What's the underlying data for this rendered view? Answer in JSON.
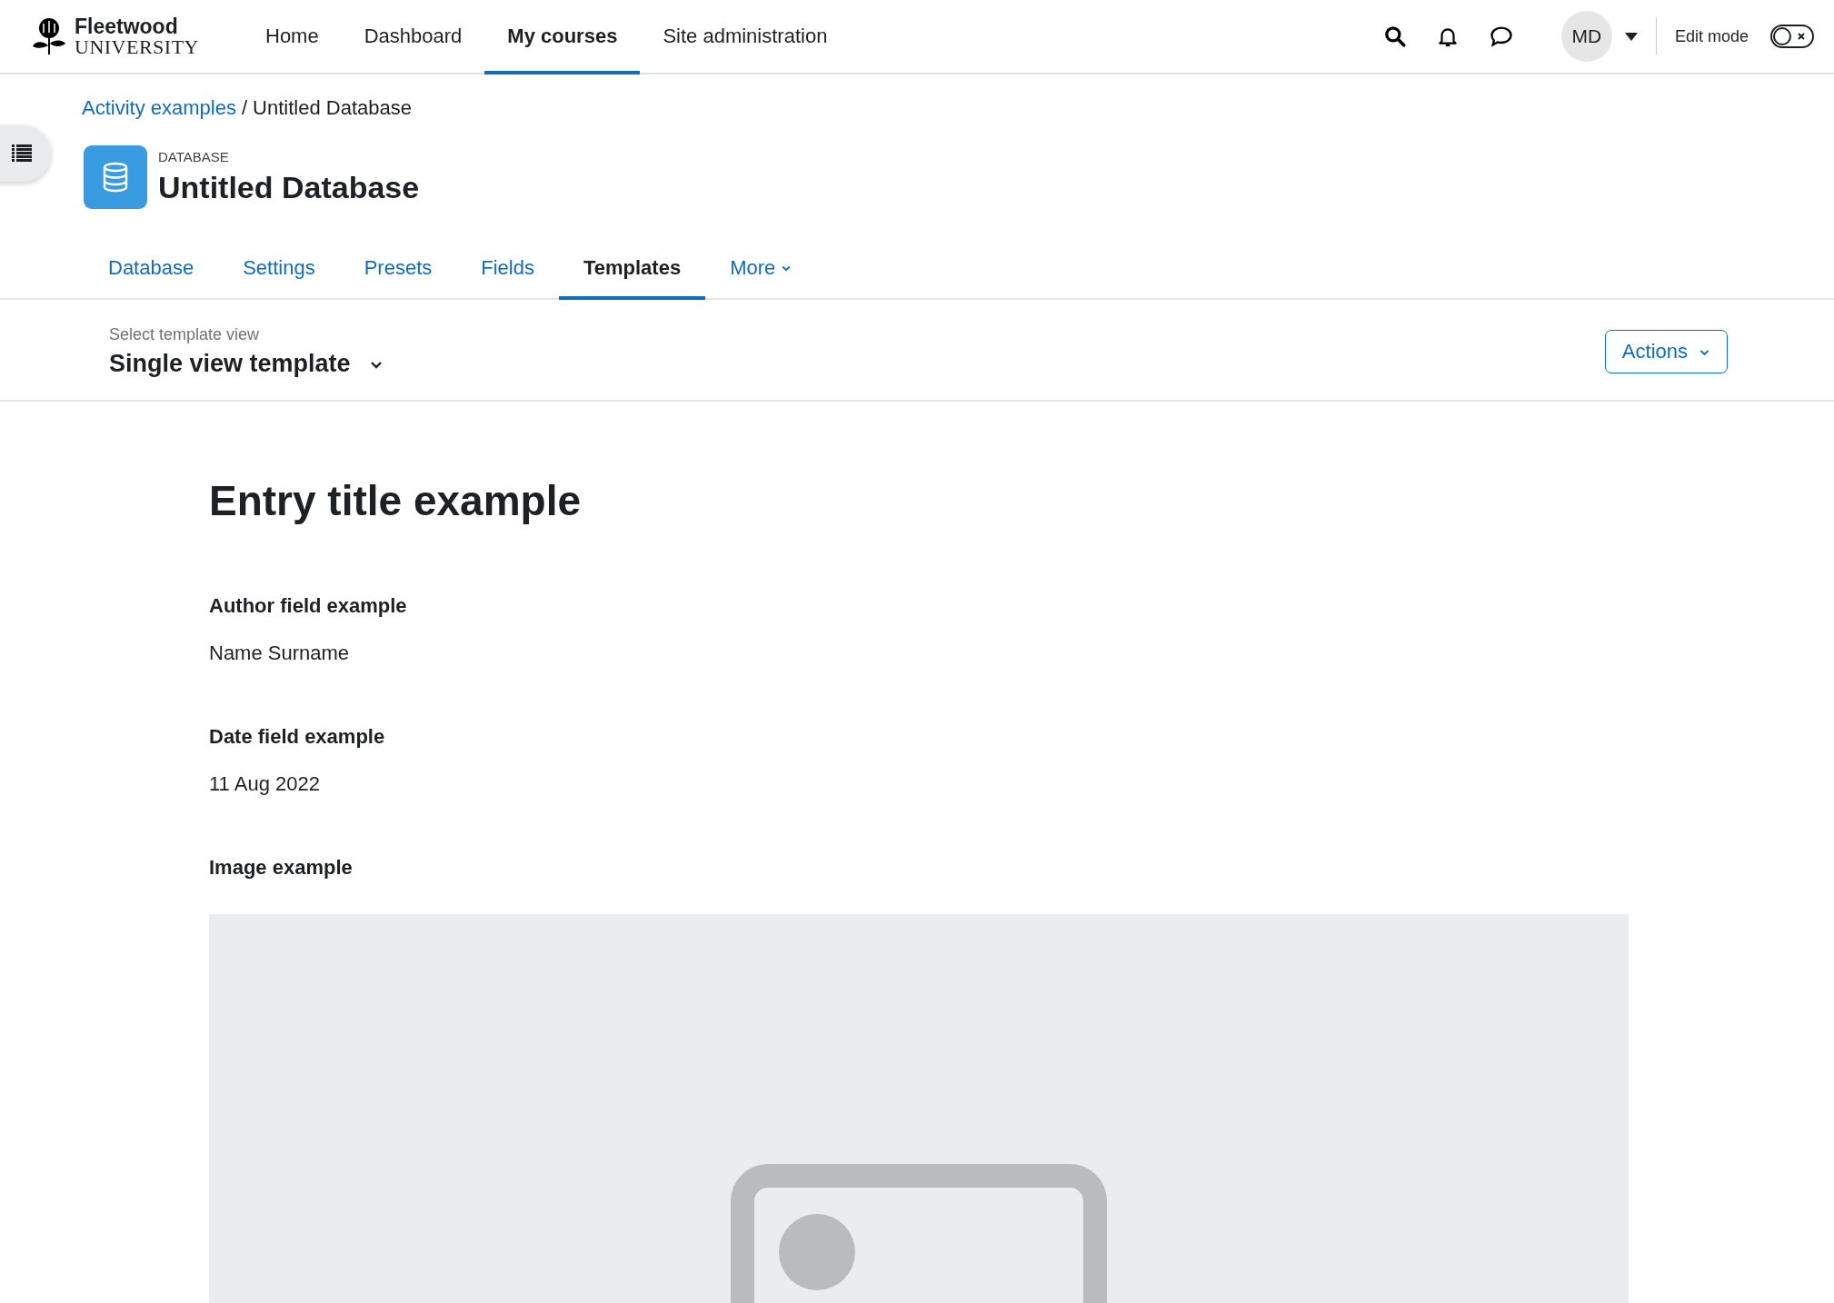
{
  "header": {
    "logo": {
      "name": "Fleetwood",
      "subtitle": "UNIVERSITY"
    },
    "nav": [
      {
        "label": "Home",
        "selected": false
      },
      {
        "label": "Dashboard",
        "selected": false
      },
      {
        "label": "My courses",
        "selected": true
      },
      {
        "label": "Site administration",
        "selected": false
      }
    ],
    "user": {
      "initials": "MD"
    },
    "edit_mode": {
      "label": "Edit mode",
      "on": false
    }
  },
  "breadcrumb": {
    "separator": "/",
    "items": [
      {
        "label": "Activity examples",
        "kind": "link"
      },
      {
        "label": "Untitled Database",
        "kind": "current"
      }
    ]
  },
  "activity": {
    "type": "DATABASE",
    "title": "Untitled Database"
  },
  "tabs": [
    {
      "label": "Database",
      "selected": false,
      "kind": "tab"
    },
    {
      "label": "Settings",
      "selected": false,
      "kind": "tab"
    },
    {
      "label": "Presets",
      "selected": false,
      "kind": "tab"
    },
    {
      "label": "Fields",
      "selected": false,
      "kind": "tab"
    },
    {
      "label": "Templates",
      "selected": true,
      "kind": "tab"
    },
    {
      "label": "More",
      "selected": false,
      "kind": "menu"
    }
  ],
  "template_select": {
    "label": "Select template view",
    "value": "Single view template"
  },
  "actions_button": {
    "label": "Actions"
  },
  "entry": {
    "title": "Entry title example",
    "fields": [
      {
        "label": "Author field example",
        "value": "Name Surname",
        "kind": "text"
      },
      {
        "label": "Date field example",
        "value": "11 Aug 2022",
        "kind": "text"
      },
      {
        "label": "Image example",
        "kind": "image"
      }
    ]
  }
}
